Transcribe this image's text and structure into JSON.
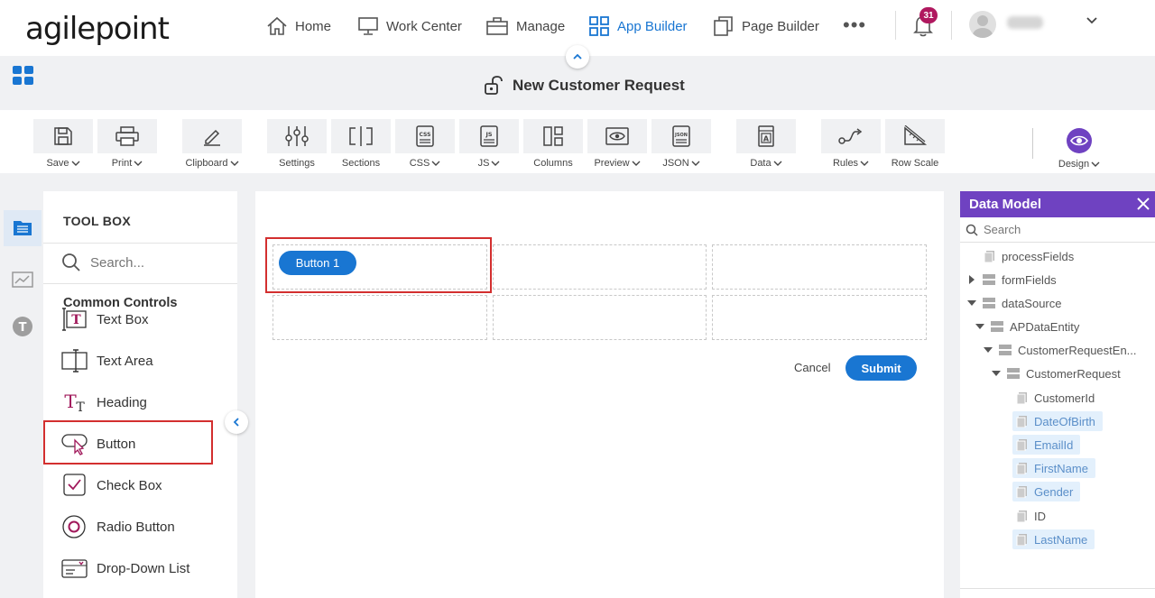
{
  "brand": {
    "logo_text": "agilepoint"
  },
  "nav": {
    "items": [
      {
        "label": "Home",
        "icon": "home-icon"
      },
      {
        "label": "Work Center",
        "icon": "monitor-icon"
      },
      {
        "label": "Manage",
        "icon": "briefcase-icon"
      },
      {
        "label": "App Builder",
        "icon": "grid-icon",
        "active": true
      },
      {
        "label": "Page Builder",
        "icon": "pages-icon"
      }
    ],
    "more": "•••",
    "notifications_count": "31",
    "accent_color": "#1976d2"
  },
  "form": {
    "title": "New Customer Request"
  },
  "ribbon": {
    "tools": [
      {
        "label": "Save",
        "dropdown": true
      },
      {
        "label": "Print",
        "dropdown": true
      },
      {
        "label": "Clipboard",
        "dropdown": true
      },
      {
        "label": "Settings",
        "dropdown": false
      },
      {
        "label": "Sections",
        "dropdown": false
      },
      {
        "label": "CSS",
        "dropdown": true
      },
      {
        "label": "JS",
        "dropdown": true
      },
      {
        "label": "Columns",
        "dropdown": false
      },
      {
        "label": "Preview",
        "dropdown": true
      },
      {
        "label": "JSON",
        "dropdown": true
      },
      {
        "label": "Data",
        "dropdown": true
      },
      {
        "label": "Rules",
        "dropdown": true
      },
      {
        "label": "Row Scale",
        "dropdown": false
      },
      {
        "label": "Design",
        "dropdown": true
      }
    ]
  },
  "toolbox": {
    "title": "TOOL BOX",
    "search_placeholder": "Search...",
    "category": "Common Controls",
    "items": [
      {
        "label": "Text Box"
      },
      {
        "label": "Text Area"
      },
      {
        "label": "Heading"
      },
      {
        "label": "Button"
      },
      {
        "label": "Check Box"
      },
      {
        "label": "Radio Button"
      },
      {
        "label": "Drop-Down List"
      }
    ]
  },
  "canvas": {
    "button_label": "Button 1",
    "cancel_label": "Cancel",
    "submit_label": "Submit"
  },
  "data_model": {
    "title": "Data Model",
    "search_placeholder": "Search",
    "tree": [
      {
        "label": "processFields"
      },
      {
        "label": "formFields"
      },
      {
        "label": "dataSource"
      },
      {
        "label": "APDataEntity"
      },
      {
        "label": "CustomerRequestEn..."
      },
      {
        "label": "CustomerRequest"
      },
      {
        "label": "CustomerId"
      },
      {
        "label": "DateOfBirth",
        "selected": true
      },
      {
        "label": "EmailId",
        "selected": true
      },
      {
        "label": "FirstName",
        "selected": true
      },
      {
        "label": "Gender",
        "selected": true
      },
      {
        "label": "ID"
      },
      {
        "label": "LastName",
        "selected": true
      }
    ],
    "header_color": "#6f42c1"
  }
}
